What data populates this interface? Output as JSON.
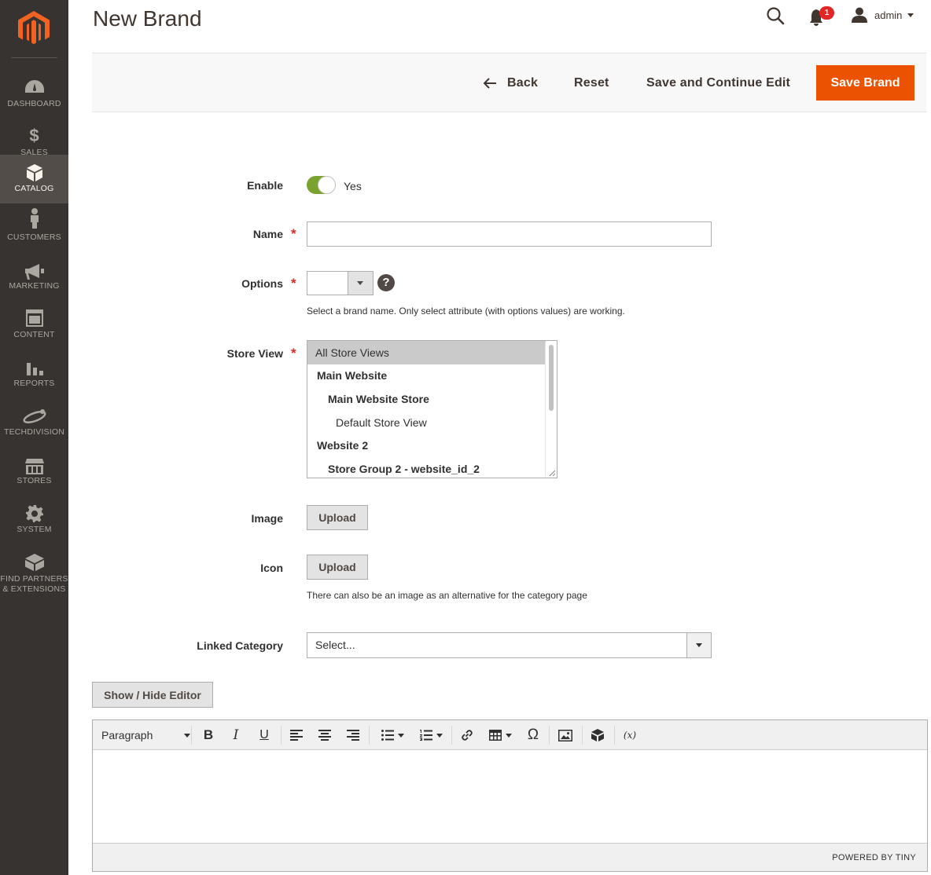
{
  "sidebar": {
    "items": [
      {
        "label": "DASHBOARD",
        "icon": "dashboard-icon",
        "active": false
      },
      {
        "label": "SALES",
        "icon": "dollar-icon",
        "active": false
      },
      {
        "label": "CATALOG",
        "icon": "box-icon",
        "active": true
      },
      {
        "label": "CUSTOMERS",
        "icon": "person-icon",
        "active": false
      },
      {
        "label": "MARKETING",
        "icon": "megaphone-icon",
        "active": false
      },
      {
        "label": "CONTENT",
        "icon": "layout-icon",
        "active": false
      },
      {
        "label": "REPORTS",
        "icon": "bar-chart-icon",
        "active": false
      },
      {
        "label": "TECHDIVISION",
        "icon": "techdivision-icon",
        "active": false
      },
      {
        "label": "STORES",
        "icon": "store-icon",
        "active": false
      },
      {
        "label": "SYSTEM",
        "icon": "gear-icon",
        "active": false
      },
      {
        "label": "FIND PARTNERS & EXTENSIONS",
        "icon": "extensions-icon",
        "active": false
      }
    ]
  },
  "header": {
    "title": "New Brand",
    "notifications_count": "1",
    "user": "admin"
  },
  "actions": {
    "back": "Back",
    "reset": "Reset",
    "save_continue": "Save and Continue Edit",
    "save": "Save Brand"
  },
  "form": {
    "enable": {
      "label": "Enable",
      "value_text": "Yes"
    },
    "name": {
      "label": "Name",
      "value": ""
    },
    "options": {
      "label": "Options",
      "value": "",
      "note": "Select a brand name. Only select attribute (with options values) are working."
    },
    "store_view": {
      "label": "Store View",
      "options": [
        {
          "text": "All Store Views",
          "level": 0,
          "bold": false,
          "selected": true
        },
        {
          "text": "Main Website",
          "level": 1,
          "bold": true,
          "selected": false
        },
        {
          "text": "Main Website Store",
          "level": 2,
          "bold": true,
          "selected": false
        },
        {
          "text": "Default Store View",
          "level": 3,
          "bold": false,
          "selected": false
        },
        {
          "text": "Website 2",
          "level": 1,
          "bold": true,
          "selected": false
        },
        {
          "text": "Store Group 2 - website_id_2",
          "level": 2,
          "bold": true,
          "selected": false
        }
      ]
    },
    "image": {
      "label": "Image",
      "button": "Upload"
    },
    "icon": {
      "label": "Icon",
      "button": "Upload",
      "note": "There can also be an image as an alternative for the category page"
    },
    "linked_category": {
      "label": "Linked Category",
      "value": "Select..."
    }
  },
  "editor": {
    "toggle_button": "Show / Hide Editor",
    "block_format": "Paragraph",
    "powered_by": "POWERED BY TINY",
    "variable_button": "(x)"
  },
  "colors": {
    "accent": "#eb5202",
    "sidebar_bg": "#373330",
    "toggle_on": "#79a22e",
    "badge": "#e22626"
  }
}
